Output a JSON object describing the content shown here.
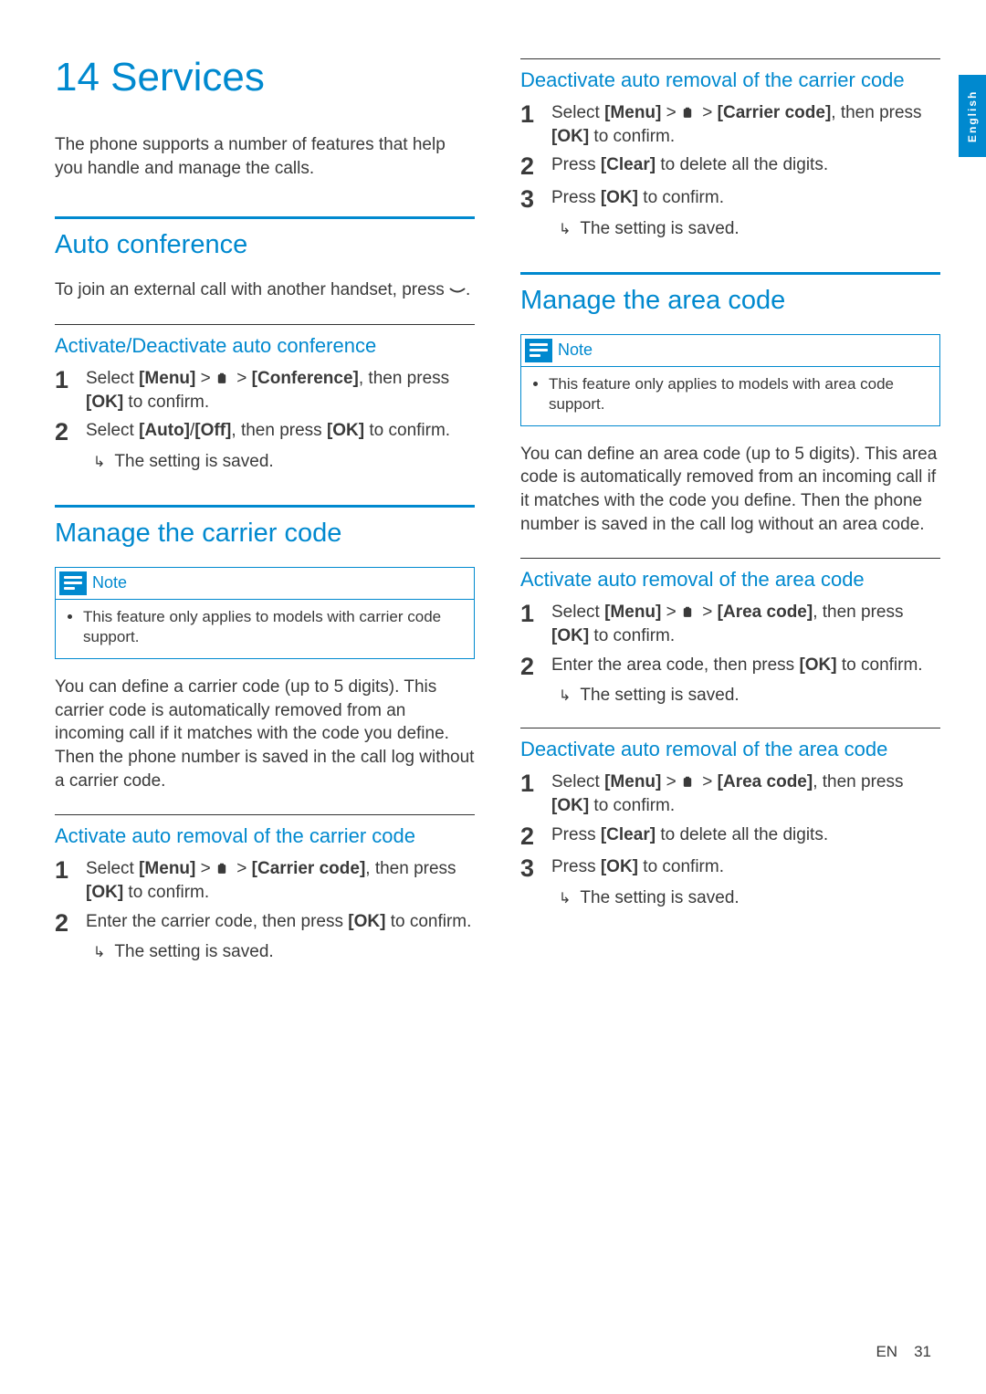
{
  "lang_tab": "English",
  "footer": {
    "lang": "EN",
    "page": "31"
  },
  "left": {
    "chapter_title": "14 Services",
    "intro": "The phone supports a number of features that help you handle and manage the calls.",
    "auto_conf": {
      "heading": "Auto conference",
      "body_pre": "To join an external call with another handset, press ",
      "body_post": ".",
      "sub_heading": "Activate/Deactivate auto conference",
      "step1_pre": "Select ",
      "step1_menu": "[Menu]",
      "step1_gt1": " > ",
      "step1_gt2": " > ",
      "step1_conf": "[Conference]",
      "step1_post": ", then press ",
      "step1_ok": "[OK]",
      "step1_end": " to confirm.",
      "step2_pre": "Select ",
      "step2_auto": "[Auto]",
      "step2_slash": "/",
      "step2_off": "[Off]",
      "step2_post": ", then press ",
      "step2_ok": "[OK]",
      "step2_end": " to confirm.",
      "result": "The setting is saved."
    },
    "carrier": {
      "heading": "Manage the carrier code",
      "note_label": "Note",
      "note_text": "This feature only applies to models with carrier code support.",
      "body": "You can define a carrier code (up to 5 digits). This carrier code is automatically removed from an incoming call if it matches with the code you define. Then the phone number is saved in the call log without a carrier code.",
      "activate_heading": "Activate auto removal of the carrier code",
      "a_step1_pre": "Select ",
      "a_step1_menu": "[Menu]",
      "a_step1_gt1": " > ",
      "a_step1_gt2": " > ",
      "a_step1_cc": "[Carrier code]",
      "a_step1_post": ", then press ",
      "a_step1_ok": "[OK]",
      "a_step1_end": " to confirm.",
      "a_step2_pre": "Enter the carrier code, then press ",
      "a_step2_ok": "[OK]",
      "a_step2_end": " to confirm.",
      "a_result": "The setting is saved."
    }
  },
  "right": {
    "deact_carrier": {
      "heading": "Deactivate auto removal of the carrier code",
      "step1_pre": "Select ",
      "step1_menu": "[Menu]",
      "step1_gt1": " > ",
      "step1_gt2": " > ",
      "step1_cc": "[Carrier code]",
      "step1_post": ", then press ",
      "step1_ok": "[OK]",
      "step1_end": " to confirm.",
      "step2_pre": "Press ",
      "step2_clear": "[Clear]",
      "step2_end": " to delete all the digits.",
      "step3_pre": "Press ",
      "step3_ok": "[OK]",
      "step3_end": " to confirm.",
      "result": "The setting is saved."
    },
    "area": {
      "heading": "Manage the area code",
      "note_label": "Note",
      "note_text": "This feature only applies to models with area code support.",
      "body": "You can define an area code (up to 5 digits). This area code is automatically removed from an incoming call if it matches with the code you define. Then the phone number is saved in the call log without an area code.",
      "activate_heading": "Activate auto removal of the area code",
      "a_step1_pre": "Select ",
      "a_step1_menu": "[Menu]",
      "a_step1_gt1": " > ",
      "a_step1_gt2": " > ",
      "a_step1_ac": "[Area code]",
      "a_step1_post": ", then press ",
      "a_step1_ok": "[OK]",
      "a_step1_end": " to confirm.",
      "a_step2_pre": "Enter the area code, then press ",
      "a_step2_ok": "[OK]",
      "a_step2_end": " to confirm.",
      "a_result": "The setting is saved.",
      "deactivate_heading": "Deactivate auto removal of the area code",
      "d_step1_pre": "Select ",
      "d_step1_menu": "[Menu]",
      "d_step1_gt1": " > ",
      "d_step1_gt2": " > ",
      "d_step1_ac": "[Area code]",
      "d_step1_post": ", then press ",
      "d_step1_ok": "[OK]",
      "d_step1_end": " to confirm.",
      "d_step2_pre": "Press ",
      "d_step2_clear": "[Clear]",
      "d_step2_end": " to delete all the digits.",
      "d_step3_pre": "Press ",
      "d_step3_ok": "[OK]",
      "d_step3_end": " to confirm.",
      "d_result": "The setting is saved."
    }
  }
}
